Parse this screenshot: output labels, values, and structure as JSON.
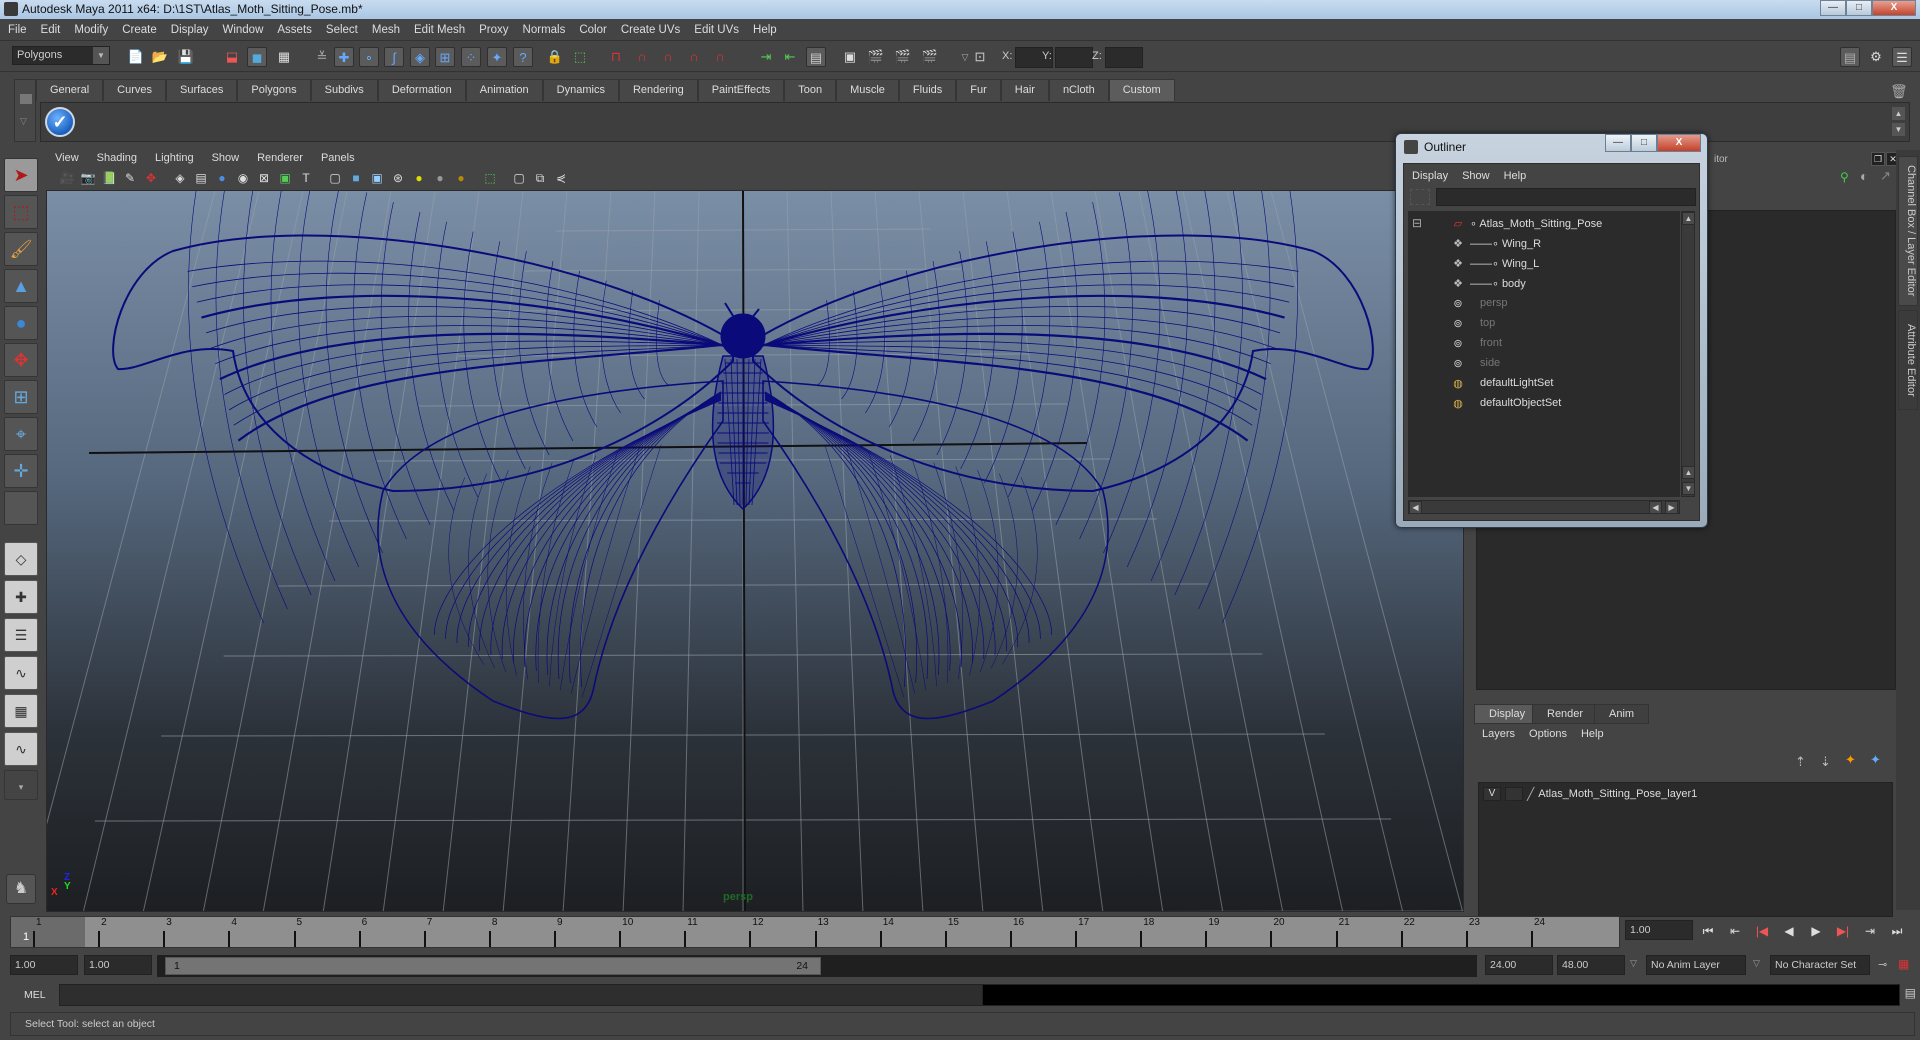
{
  "window": {
    "title": "Autodesk Maya 2011 x64: D:\\1ST\\Atlas_Moth_Sitting_Pose.mb*",
    "controls": {
      "minimize": "—",
      "maximize": "□",
      "close": "X"
    }
  },
  "menubar": [
    "File",
    "Edit",
    "Modify",
    "Create",
    "Display",
    "Window",
    "Assets",
    "Select",
    "Mesh",
    "Edit Mesh",
    "Proxy",
    "Normals",
    "Color",
    "Create UVs",
    "Edit UVs",
    "Help"
  ],
  "statusline": {
    "mode": "Polygons",
    "xyz_labels": [
      "X:",
      "Y:",
      "Z:"
    ],
    "xyz_values": [
      "",
      "",
      ""
    ]
  },
  "shelf": {
    "tabs": [
      "General",
      "Curves",
      "Surfaces",
      "Polygons",
      "Subdivs",
      "Deformation",
      "Animation",
      "Dynamics",
      "Rendering",
      "PaintEffects",
      "Toon",
      "Muscle",
      "Fluids",
      "Fur",
      "Hair",
      "nCloth",
      "Custom"
    ],
    "active_tab": "Custom",
    "items": [
      {
        "icon": "checkmark-icon"
      }
    ]
  },
  "toolbox": {
    "tools": [
      "select-tool",
      "lasso-tool",
      "paint-select-tool",
      "move-tool",
      "rotate-tool",
      "scale-tool",
      "universal-manipulator",
      "soft-mod-tool",
      "show-manipulator",
      "last-tool"
    ],
    "selected": "select-tool"
  },
  "viewport": {
    "menu": [
      "View",
      "Shading",
      "Lighting",
      "Show",
      "Renderer",
      "Panels"
    ],
    "camera_label": "persp",
    "axis_labels": {
      "x": "X",
      "y": "Y",
      "z": "Z"
    },
    "wire_color": "#0b0a7a"
  },
  "outliner": {
    "title": "Outliner",
    "menu": [
      "Display",
      "Show",
      "Help"
    ],
    "filter_value": "",
    "items": [
      {
        "label": "Atlas_Moth_Sitting_Pose",
        "icon": "group-transform-icon",
        "level": 0,
        "expanded": true,
        "dim": false
      },
      {
        "label": "Wing_R",
        "icon": "mesh-icon",
        "level": 1,
        "dim": false
      },
      {
        "label": "Wing_L",
        "icon": "mesh-icon",
        "level": 1,
        "dim": false
      },
      {
        "label": "body",
        "icon": "mesh-icon",
        "level": 1,
        "dim": false
      },
      {
        "label": "persp",
        "icon": "camera-icon",
        "level": 0,
        "dim": true
      },
      {
        "label": "top",
        "icon": "camera-icon",
        "level": 0,
        "dim": true
      },
      {
        "label": "front",
        "icon": "camera-icon",
        "level": 0,
        "dim": true
      },
      {
        "label": "side",
        "icon": "camera-icon",
        "level": 0,
        "dim": true
      },
      {
        "label": "defaultLightSet",
        "icon": "set-icon",
        "level": 0,
        "dim": false
      },
      {
        "label": "defaultObjectSet",
        "icon": "set-icon",
        "level": 0,
        "dim": false
      }
    ]
  },
  "channel_box": {
    "header_partial": "itor",
    "side_tabs": [
      "Channel Box / Layer Editor",
      "Attribute Editor"
    ]
  },
  "layer_editor": {
    "tabs": [
      "Display",
      "Render",
      "Anim"
    ],
    "active_tab": "Display",
    "menu": [
      "Layers",
      "Options",
      "Help"
    ],
    "layers": [
      {
        "visible": "V",
        "type": "",
        "name": "Atlas_Moth_Sitting_Pose_layer1"
      }
    ]
  },
  "timeline": {
    "ticks": [
      1,
      2,
      3,
      4,
      5,
      6,
      7,
      8,
      9,
      10,
      11,
      12,
      13,
      14,
      15,
      16,
      17,
      18,
      19,
      20,
      21,
      22,
      23,
      24
    ],
    "current_frame_marker": "1",
    "current_frame": "1.00",
    "playback_buttons": [
      "go-to-start",
      "step-back-key",
      "step-back-frame",
      "play-backward",
      "play-forward",
      "step-forward-frame",
      "step-forward-key",
      "go-to-end"
    ]
  },
  "range": {
    "start_time": "1.00",
    "playback_start": "1.00",
    "range_min_label": "1",
    "range_max_label": "24",
    "playback_end": "24.00",
    "end_time": "48.00",
    "anim_layer": "No Anim Layer",
    "character_set": "No Character Set"
  },
  "command_line": {
    "label": "MEL",
    "value": "",
    "result": ""
  },
  "help_line": "Select Tool: select an object"
}
